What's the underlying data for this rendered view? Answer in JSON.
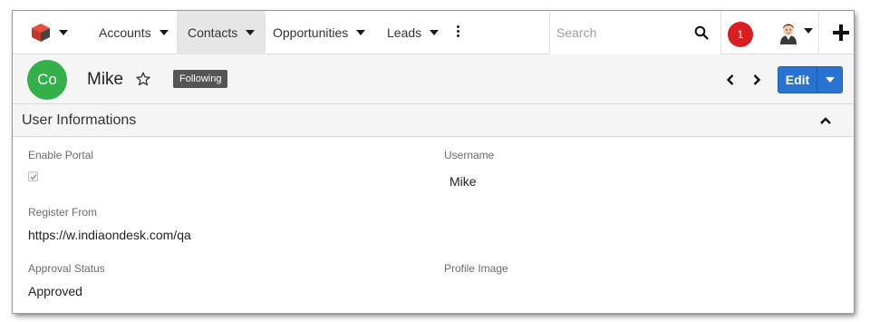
{
  "nav": {
    "items": [
      {
        "label": "Accounts"
      },
      {
        "label": "Contacts"
      },
      {
        "label": "Opportunities"
      },
      {
        "label": "Leads"
      }
    ],
    "search_placeholder": "Search",
    "notification_count": "1",
    "icons": {
      "logo": "cube-logo-icon",
      "more": "more-vertical-icon",
      "search": "search-icon",
      "avatar": "user-avatar",
      "plus": "plus-icon"
    }
  },
  "record": {
    "avatar_initials": "Co",
    "name": "Mike",
    "following_label": "Following",
    "edit_label": "Edit"
  },
  "panel": {
    "title": "User Informations",
    "fields": {
      "enable_portal": {
        "label": "Enable Portal",
        "checked": true
      },
      "username": {
        "label": "Username",
        "value": "Mike"
      },
      "register_from": {
        "label": "Register From",
        "value": "https://w.indiaondesk.com/qa"
      },
      "approval_status": {
        "label": "Approval Status",
        "value": "Approved"
      },
      "profile_image": {
        "label": "Profile Image"
      }
    }
  },
  "colors": {
    "avatar_bg": "#33b04a",
    "badge_bg": "#d81e1e",
    "primary": "#2a72d2",
    "following_bg": "#555555"
  }
}
